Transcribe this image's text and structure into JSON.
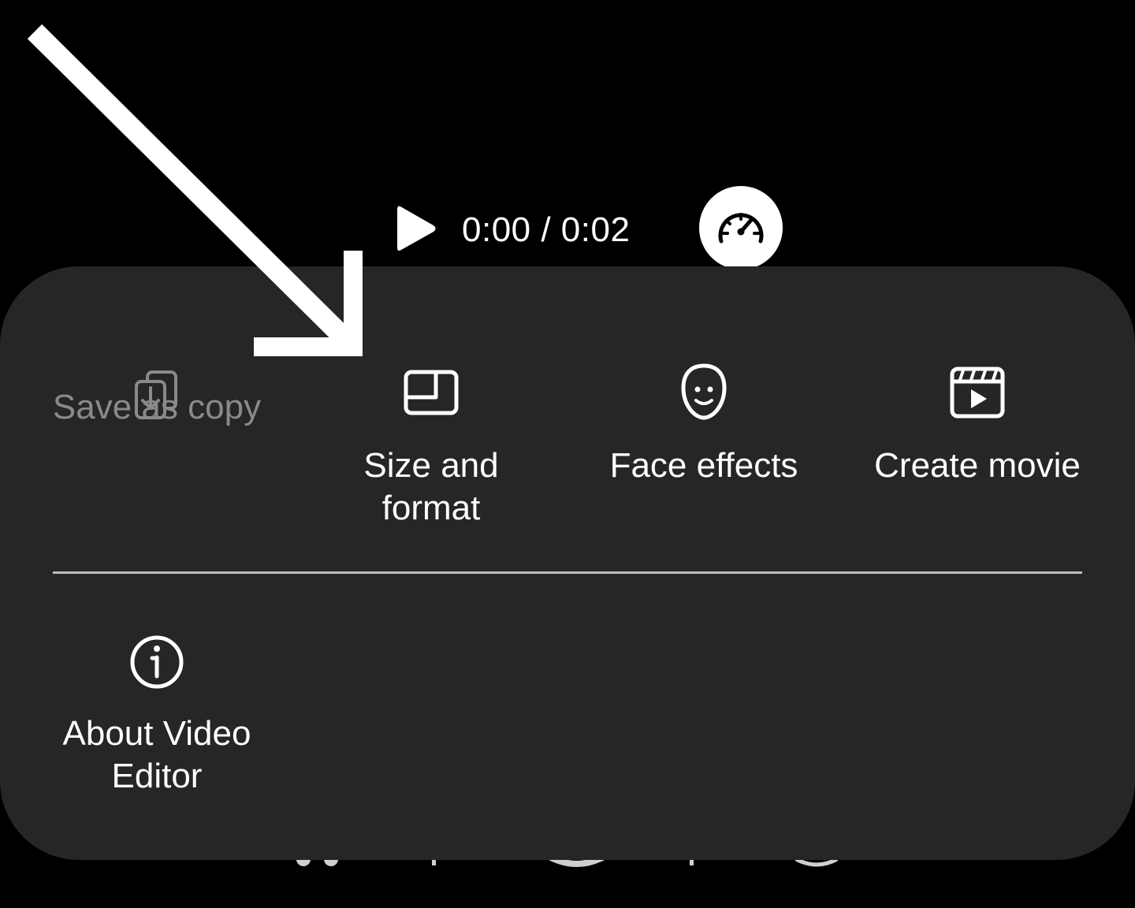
{
  "player": {
    "time": "0:00 / 0:02",
    "play_icon": "play-icon",
    "speed_icon": "speedometer-icon"
  },
  "menu": {
    "items": [
      {
        "label": "Save as copy",
        "icon": "save-copy-icon",
        "enabled": false
      },
      {
        "label": "Size and\nformat",
        "icon": "size-format-icon",
        "enabled": true
      },
      {
        "label": "Face effects",
        "icon": "face-icon",
        "enabled": true
      },
      {
        "label": "Create movie",
        "icon": "movie-clapper-icon",
        "enabled": true
      },
      {
        "label": "About Video\nEditor",
        "icon": "info-icon",
        "enabled": true
      }
    ]
  },
  "colors": {
    "background": "#000000",
    "sheet": "#262626",
    "text": "#ffffff",
    "disabled_text": "#8a8a8a",
    "divider": "#bdbdbd",
    "annotation": "#ffffff"
  }
}
